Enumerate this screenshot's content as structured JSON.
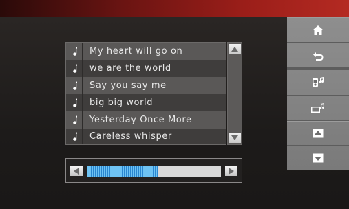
{
  "playlist": {
    "songs": [
      "My heart will go on",
      "we are the world",
      "Say you say me",
      "big big world",
      "Yesterday Once More",
      "Careless whisper"
    ]
  },
  "progress": {
    "value": 0.53
  },
  "sidebar": {
    "buttons": [
      "home-icon",
      "back-icon",
      "music-device-icon",
      "music-card-icon",
      "page-up-icon",
      "page-down-icon"
    ]
  },
  "colors": {
    "topbar": "#9b1e19",
    "progress_fill": "#4aa8e6",
    "list_bg": "#4a4847"
  }
}
